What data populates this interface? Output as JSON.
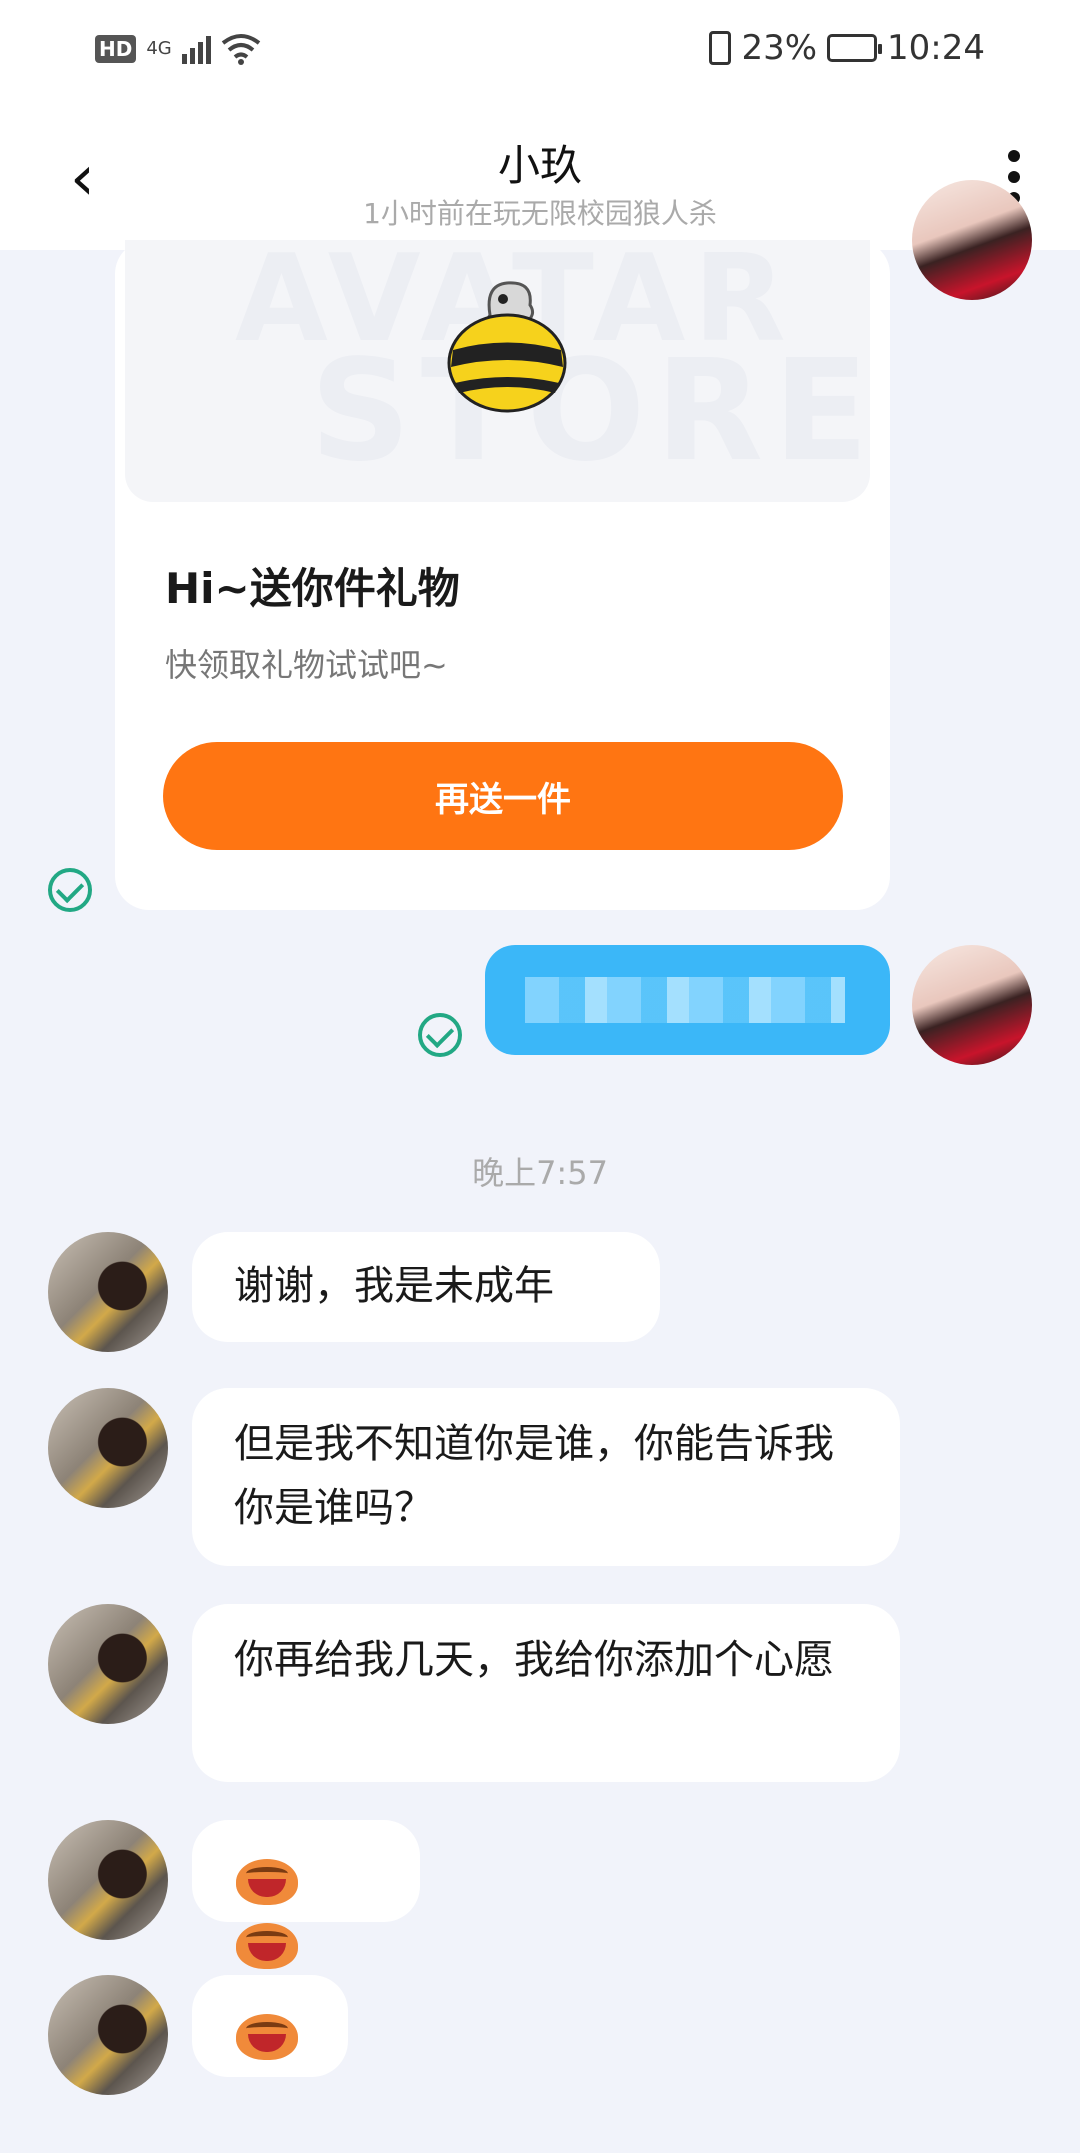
{
  "status_bar": {
    "hd": "HD",
    "network": "4G",
    "battery": "23%",
    "battery_level": 0.23,
    "time": "10:24"
  },
  "header": {
    "title": "小玖",
    "subtitle": "1小时前在玩无限校园狼人杀"
  },
  "gift_card": {
    "watermark_top": "AVATAR",
    "watermark_bottom": "STORE",
    "title": "Hi~送你件礼物",
    "subtitle": "快领取礼物试试吧~",
    "button_label": "再送一件"
  },
  "timestamp": "晚上7:57",
  "messages": [
    {
      "text": "谢谢，我是未成年"
    },
    {
      "text": "但是我不知道你是谁，你能告诉我你是谁吗？"
    },
    {
      "text": "你再给我几天，我给你添加个心愿"
    },
    {
      "emoji_count": 2
    },
    {
      "emoji_count": 1
    }
  ],
  "colors": {
    "accent_orange": "#ff7512",
    "outgoing_bubble": "#3bb7f8",
    "read_check": "#22a884",
    "background": "#f1f3fa"
  }
}
